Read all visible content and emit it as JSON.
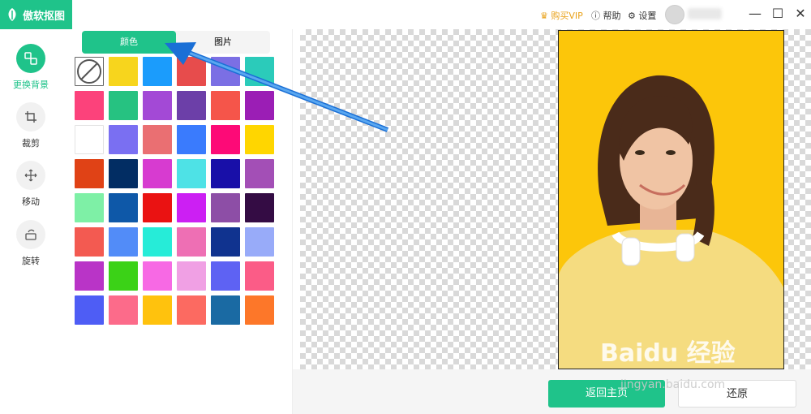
{
  "app": {
    "title": "傲软抠图",
    "brand_color": "#1fc38a"
  },
  "topbar": {
    "vip": "购买VIP",
    "help": "帮助",
    "settings": "设置"
  },
  "sidebar": {
    "items": [
      {
        "label": "更换背景",
        "icon": "replace-bg-icon",
        "active": true
      },
      {
        "label": "裁剪",
        "icon": "crop-icon"
      },
      {
        "label": "移动",
        "icon": "move-icon"
      },
      {
        "label": "旋转",
        "icon": "rotate-icon"
      }
    ]
  },
  "tabs": [
    {
      "label": "颜色",
      "active": true
    },
    {
      "label": "图片"
    }
  ],
  "colors": [
    [
      "none",
      "#f7d51d",
      "#1b9cfc",
      "#e74c4c",
      "#7b6fe4",
      "#2bcbba"
    ],
    [
      "#fc427b",
      "#26c281",
      "#a349d6",
      "#6c3fa8",
      "#f5554a",
      "#9b1eb5"
    ],
    [
      "#ffffff",
      "#7a6ff2",
      "#ea6f72",
      "#3a7bfd",
      "#fd0a77",
      "#ffd600"
    ],
    [
      "#e04216",
      "#022d63",
      "#d73bd0",
      "#4ee2e6",
      "#180fa8",
      "#a34fb6"
    ],
    [
      "#7ef0a6",
      "#0e58a8",
      "#ea1212",
      "#cc1ff3",
      "#8d4ea6",
      "#340c44"
    ],
    [
      "#f35a51",
      "#528cf8",
      "#26ecd8",
      "#ee6fb4",
      "#10338f",
      "#98abf9"
    ],
    [
      "#b934c7",
      "#3bd217",
      "#f769e4",
      "#f0a0e4",
      "#5e62f3",
      "#fb5c87"
    ],
    [
      "#4e5df5",
      "#fc6b8a",
      "#ffc20d",
      "#fc6a61",
      "#1a6aa3",
      "#fd7729"
    ]
  ],
  "preview": {
    "background": "#fcc60a"
  },
  "footer": {
    "back_home": "返回主页",
    "restore": "还原"
  },
  "watermark": {
    "main": "Baidu 经验",
    "sub": "jingyan.baidu.com"
  }
}
